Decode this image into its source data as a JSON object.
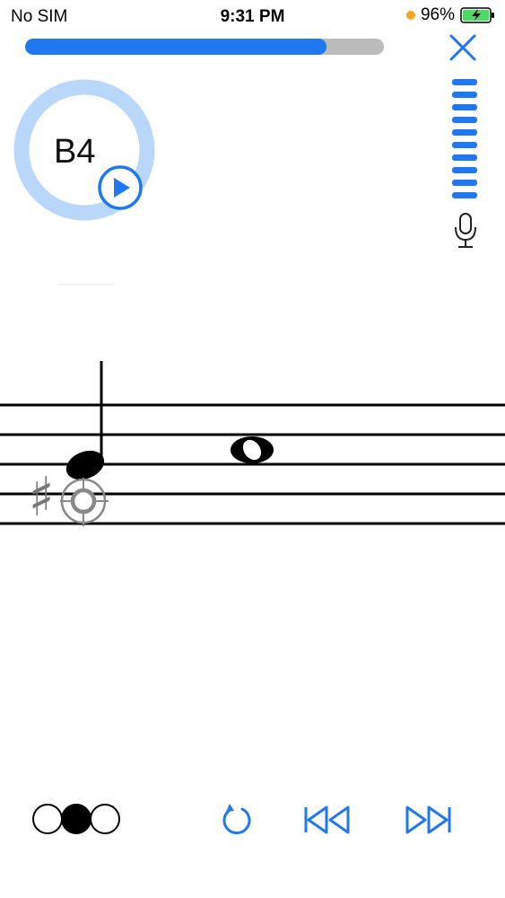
{
  "status_bar": {
    "carrier": "No SIM",
    "time": "9:31 PM",
    "battery": "96%"
  },
  "lesson": {
    "progress": 0.84
  },
  "note": {
    "name": "B4"
  },
  "level_meter": {
    "bars": 10
  },
  "staff": {
    "accidental": "♯"
  },
  "pagination": {
    "pages": 3,
    "current": 2
  },
  "colors": {
    "accent": "#1f78f0",
    "ring": "#b9d7fb",
    "track": "#bbbbbb",
    "battery_green": "#4cd964",
    "dot_orange": "#f5a623"
  }
}
